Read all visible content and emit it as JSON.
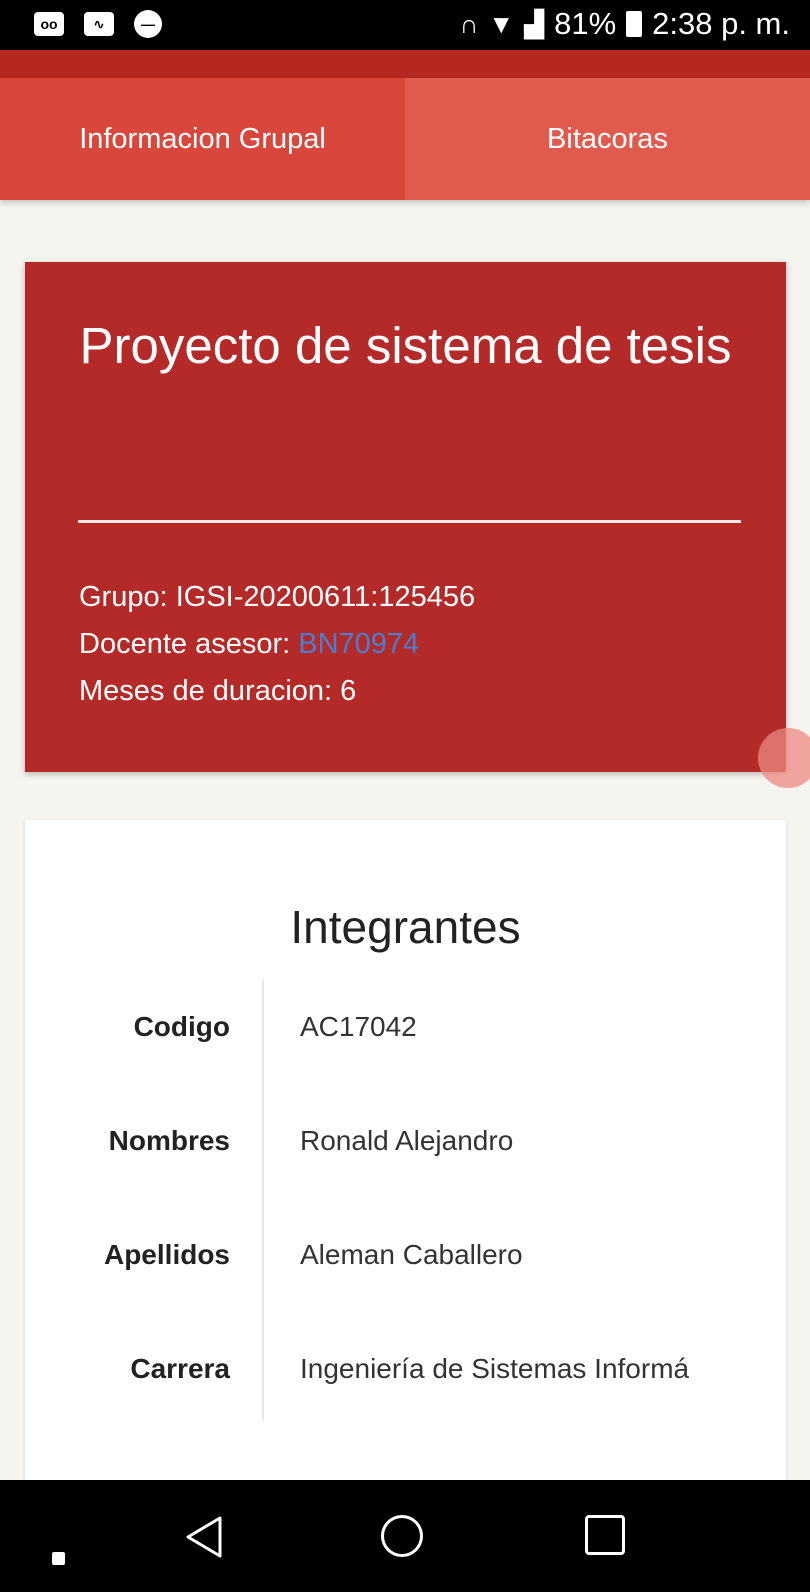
{
  "status_bar": {
    "icons_left": [
      "voicemail-icon",
      "activity-icon",
      "do-not-disturb-icon"
    ],
    "icons_right": [
      "headphones-icon",
      "wifi-icon",
      "signal-icon",
      "battery-icon"
    ],
    "battery": "81%",
    "time": "2:38 p. m."
  },
  "tabs": [
    {
      "label": "Informacion Grupal"
    },
    {
      "label": "Bitacoras"
    }
  ],
  "project": {
    "title": "Proyecto de sistema de tesis",
    "group_label": "Grupo: ",
    "group_value": "IGSI-20200611:125456",
    "advisor_label": "Docente asesor: ",
    "advisor_value": "BN70974",
    "duration_label": "Meses de duracion: ",
    "duration_value": "6"
  },
  "members": {
    "title": "Integrantes",
    "rows": [
      {
        "label": "Codigo",
        "value": "AC17042"
      },
      {
        "label": "Nombres",
        "value": "Ronald Alejandro"
      },
      {
        "label": "Apellidos",
        "value": "Aleman Caballero"
      },
      {
        "label": "Carrera",
        "value": "Ingeniería de Sistemas Informá"
      }
    ]
  },
  "nav_bar": {
    "icons": [
      "square-dot-icon",
      "back-icon",
      "home-icon",
      "recents-icon"
    ]
  },
  "colors": {
    "primary": "#e05a4e",
    "hero": "#b42a28",
    "link": "#4a7fd0"
  }
}
